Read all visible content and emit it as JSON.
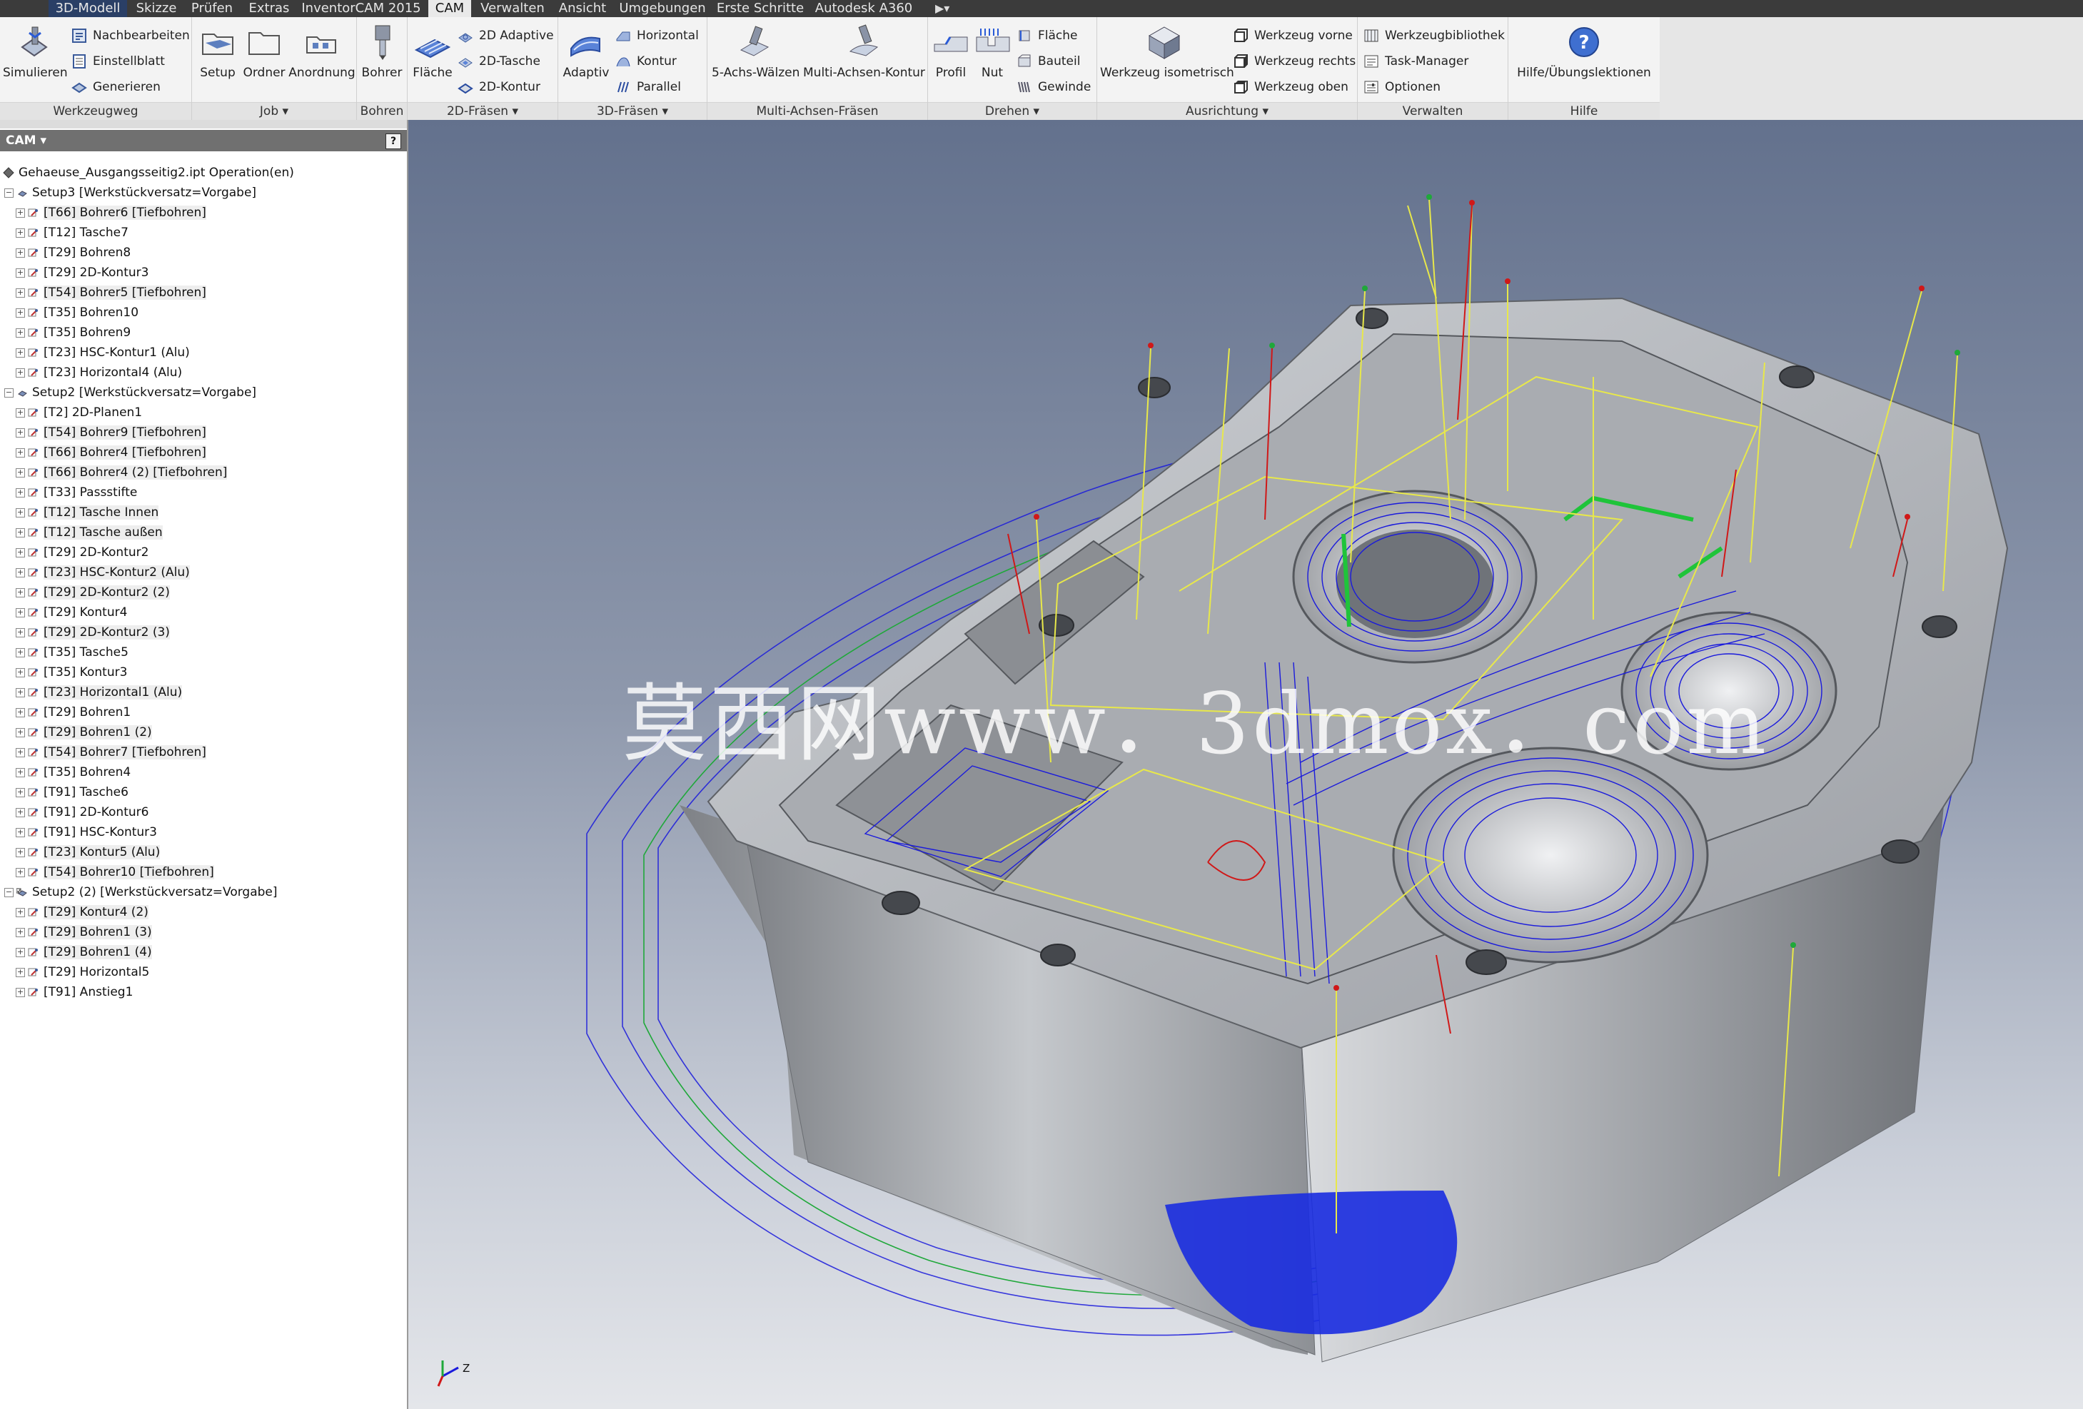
{
  "menubar": {
    "tabs": [
      "3D-Modell",
      "Skizze",
      "Prüfen",
      "Extras",
      "InventorCAM 2015",
      "CAM",
      "Verwalten",
      "Ansicht",
      "Umgebungen",
      "Erste Schritte",
      "Autodesk A360"
    ],
    "active_tab": "CAM"
  },
  "ribbon": {
    "werkzeugweg": {
      "title": "Werkzeugweg",
      "simulieren": "Simulieren",
      "nachbearbeiten": "Nachbearbeiten",
      "einstellblatt": "Einstellblatt",
      "generieren": "Generieren"
    },
    "job": {
      "title": "Job",
      "setup": "Setup",
      "ordner": "Ordner",
      "anordnung": "Anordnung"
    },
    "bohren": {
      "title": "Bohren",
      "bohrer": "Bohrer"
    },
    "fraesen2d": {
      "title": "2D-Fräsen",
      "flaeche": "Fläche",
      "adaptive": "2D Adaptive",
      "tasche": "2D-Tasche",
      "kontur": "2D-Kontur"
    },
    "fraesen3d": {
      "title": "3D-Fräsen",
      "adaptiv": "Adaptiv",
      "horizontal": "Horizontal",
      "kontur": "Kontur",
      "parallel": "Parallel"
    },
    "multiachsen": {
      "title": "Multi-Achsen-Fräsen",
      "waelzen": "5-Achs-Wälzen",
      "multikontur": "Multi-Achsen-Kontur"
    },
    "drehen": {
      "title": "Drehen",
      "profil": "Profil",
      "nut": "Nut",
      "flaeche": "Fläche",
      "bauteil": "Bauteil",
      "gewinde": "Gewinde"
    },
    "ausrichtung": {
      "title": "Ausrichtung",
      "isometrisch": "Werkzeug isometrisch",
      "vorne": "Werkzeug vorne",
      "rechts": "Werkzeug rechts",
      "oben": "Werkzeug oben"
    },
    "verwalten": {
      "title": "Verwalten",
      "bibliothek": "Werkzeugbibliothek",
      "taskmanager": "Task-Manager",
      "optionen": "Optionen"
    },
    "hilfe": {
      "title": "Hilfe",
      "lektionen": "Hilfe/Übungslektionen"
    }
  },
  "browser": {
    "title": "CAM",
    "rows": [
      {
        "level": 0,
        "type": "root",
        "label": "Gehaeuse_Ausgangsseitig2.ipt Operation(en)"
      },
      {
        "level": 1,
        "type": "setup",
        "label": "Setup3 [Werkstückversatz=Vorgabe]"
      },
      {
        "level": 2,
        "type": "op",
        "label": "[T66] Bohrer6 [Tiefbohren]",
        "hl": true
      },
      {
        "level": 2,
        "type": "op",
        "label": "[T12] Tasche7"
      },
      {
        "level": 2,
        "type": "op",
        "label": "[T29] Bohren8"
      },
      {
        "level": 2,
        "type": "op",
        "label": "[T29] 2D-Kontur3"
      },
      {
        "level": 2,
        "type": "op",
        "label": "[T54] Bohrer5 [Tiefbohren]",
        "hl": true
      },
      {
        "level": 2,
        "type": "op",
        "label": "[T35] Bohren10"
      },
      {
        "level": 2,
        "type": "op",
        "label": "[T35] Bohren9"
      },
      {
        "level": 2,
        "type": "op",
        "label": "[T23] HSC-Kontur1 (Alu)"
      },
      {
        "level": 2,
        "type": "op",
        "label": "[T23] Horizontal4 (Alu)"
      },
      {
        "level": 1,
        "type": "setup",
        "label": "Setup2 [Werkstückversatz=Vorgabe]"
      },
      {
        "level": 2,
        "type": "op",
        "label": "[T2] 2D-Planen1"
      },
      {
        "level": 2,
        "type": "op",
        "label": "[T54] Bohrer9 [Tiefbohren]",
        "hl": true
      },
      {
        "level": 2,
        "type": "op",
        "label": "[T66] Bohrer4 [Tiefbohren]",
        "hl": true
      },
      {
        "level": 2,
        "type": "op",
        "label": "[T66] Bohrer4 (2) [Tiefbohren]",
        "hl": true
      },
      {
        "level": 2,
        "type": "op",
        "label": "[T33] Passstifte"
      },
      {
        "level": 2,
        "type": "op",
        "label": "[T12] Tasche Innen",
        "hl": true
      },
      {
        "level": 2,
        "type": "op",
        "label": "[T12] Tasche außen",
        "hl": true
      },
      {
        "level": 2,
        "type": "op",
        "label": "[T29] 2D-Kontur2"
      },
      {
        "level": 2,
        "type": "op",
        "label": "[T23] HSC-Kontur2 (Alu)",
        "hl": true
      },
      {
        "level": 2,
        "type": "op",
        "label": "[T29] 2D-Kontur2 (2)",
        "hl": true
      },
      {
        "level": 2,
        "type": "op",
        "label": "[T29] Kontur4"
      },
      {
        "level": 2,
        "type": "op",
        "label": "[T29] 2D-Kontur2 (3)",
        "hl": true
      },
      {
        "level": 2,
        "type": "op",
        "label": "[T35] Tasche5"
      },
      {
        "level": 2,
        "type": "op",
        "label": "[T35] Kontur3"
      },
      {
        "level": 2,
        "type": "op",
        "label": "[T23] Horizontal1 (Alu)",
        "hl": true
      },
      {
        "level": 2,
        "type": "op",
        "label": "[T29] Bohren1"
      },
      {
        "level": 2,
        "type": "op",
        "label": "[T29] Bohren1 (2)",
        "hl": true
      },
      {
        "level": 2,
        "type": "op",
        "label": "[T54] Bohrer7 [Tiefbohren]",
        "hl": true
      },
      {
        "level": 2,
        "type": "op",
        "label": "[T35] Bohren4"
      },
      {
        "level": 2,
        "type": "op",
        "label": "[T91] Tasche6"
      },
      {
        "level": 2,
        "type": "op",
        "label": "[T91] 2D-Kontur6"
      },
      {
        "level": 2,
        "type": "op",
        "label": "[T91] HSC-Kontur3"
      },
      {
        "level": 2,
        "type": "op",
        "label": "[T23] Kontur5 (Alu)",
        "hl": true
      },
      {
        "level": 2,
        "type": "op",
        "label": "[T54] Bohrer10 [Tiefbohren]",
        "hl": true
      },
      {
        "level": 1,
        "type": "setup2",
        "label": "Setup2 (2) [Werkstückversatz=Vorgabe]"
      },
      {
        "level": 2,
        "type": "op",
        "label": "[T29] Kontur4 (2)",
        "hl": true
      },
      {
        "level": 2,
        "type": "op",
        "label": "[T29] Bohren1 (3)",
        "hl": true
      },
      {
        "level": 2,
        "type": "op",
        "label": "[T29] Bohren1 (4)",
        "hl": true
      },
      {
        "level": 2,
        "type": "op",
        "label": "[T29] Horizontal5"
      },
      {
        "level": 2,
        "type": "op",
        "label": "[T91] Anstieg1"
      }
    ]
  },
  "viewport": {
    "watermark": "莫西网www．3dmox．com",
    "axis_label": "Z"
  },
  "colors": {
    "toolpath_blue": "#1a1adc",
    "toolpath_green": "#1fa83a",
    "link_yellow": "#e8e84a",
    "retract_red": "#d01818",
    "menubar": "#3b3b3b"
  }
}
